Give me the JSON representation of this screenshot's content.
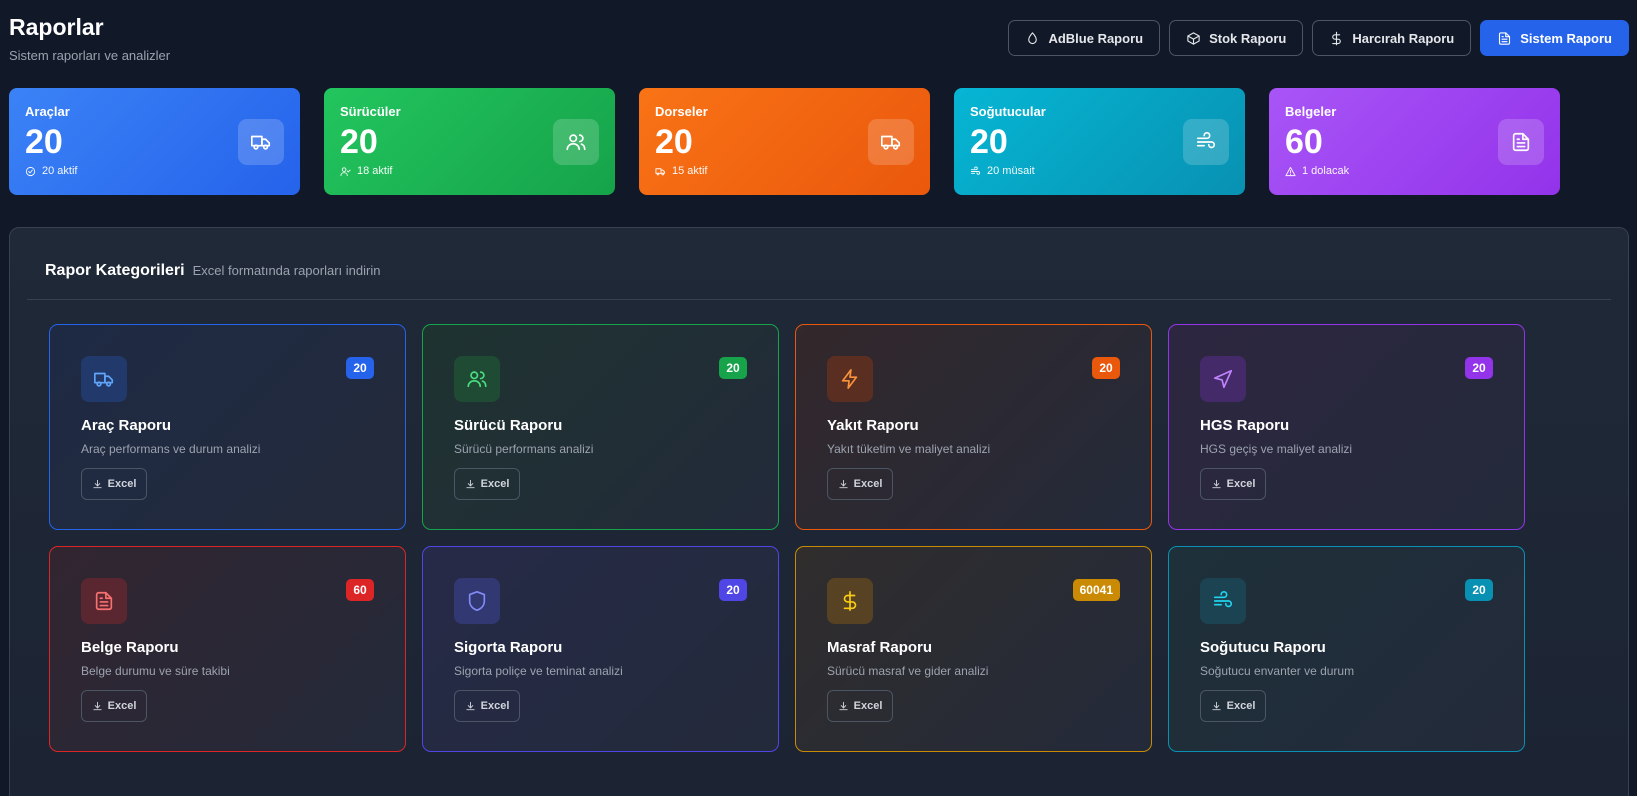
{
  "header": {
    "title": "Raporlar",
    "subtitle": "Sistem raporları ve analizler",
    "actions": [
      {
        "label": "AdBlue Raporu",
        "icon": "droplet-icon"
      },
      {
        "label": "Stok Raporu",
        "icon": "box-icon"
      },
      {
        "label": "Harcırah Raporu",
        "icon": "dollar-icon"
      },
      {
        "label": "Sistem Raporu",
        "icon": "file-text-icon",
        "primary": true
      }
    ]
  },
  "stats": [
    {
      "label": "Araçlar",
      "value": "20",
      "sub": "20 aktif",
      "icon": "truck-icon",
      "sub_icon": "check-circle-icon",
      "color_from": "#3b82f6",
      "color_to": "#2563eb"
    },
    {
      "label": "Sürücüler",
      "value": "20",
      "sub": "18 aktif",
      "icon": "users-icon",
      "sub_icon": "user-check-icon",
      "color_from": "#22c55e",
      "color_to": "#16a34a"
    },
    {
      "label": "Dorseler",
      "value": "20",
      "sub": "15 aktif",
      "icon": "truck-icon",
      "sub_icon": "truck-icon",
      "color_from": "#f97316",
      "color_to": "#ea580c"
    },
    {
      "label": "Soğutucular",
      "value": "20",
      "sub": "20 müsait",
      "icon": "wind-icon",
      "sub_icon": "wind-icon",
      "color_from": "#06b6d4",
      "color_to": "#0891b2"
    },
    {
      "label": "Belgeler",
      "value": "60",
      "sub": "1 dolacak",
      "icon": "file-text-icon",
      "sub_icon": "alert-triangle-icon",
      "color_from": "#a855f7",
      "color_to": "#9333ea"
    }
  ],
  "panel": {
    "title": "Rapor Kategorileri",
    "description": "Excel formatında raporları indirin"
  },
  "reports": [
    {
      "title": "Araç Raporu",
      "desc": "Araç performans ve durum analizi",
      "count": "20",
      "button": "Excel",
      "icon": "truck-icon",
      "accent": "#2563eb",
      "icon_color": "#60a5fa",
      "bg": "#1e2a44",
      "border": "#2563eb",
      "icon_bg": "#223a6b"
    },
    {
      "title": "Sürücü Raporu",
      "desc": "Sürücü performans analizi",
      "count": "20",
      "button": "Excel",
      "icon": "users-icon",
      "accent": "#16a34a",
      "icon_color": "#4ade80",
      "bg": "#1e3330",
      "border": "#16a34a",
      "icon_bg": "#1f4a33"
    },
    {
      "title": "Yakıt Raporu",
      "desc": "Yakıt tüketim ve maliyet analizi",
      "count": "20",
      "button": "Excel",
      "icon": "zap-icon",
      "accent": "#ea580c",
      "icon_color": "#fb923c",
      "bg": "#33282b",
      "border": "#ea580c",
      "icon_bg": "#5a2f22"
    },
    {
      "title": "HGS Raporu",
      "desc": "HGS geçiş ve maliyet analizi",
      "count": "20",
      "button": "Excel",
      "icon": "navigation-icon",
      "accent": "#9333ea",
      "icon_color": "#c084fc",
      "bg": "#2d2640",
      "border": "#9333ea",
      "icon_bg": "#452a6a"
    },
    {
      "title": "Belge Raporu",
      "desc": "Belge durumu ve süre takibi",
      "count": "60",
      "button": "Excel",
      "icon": "file-text-icon",
      "accent": "#dc2626",
      "icon_color": "#f87171",
      "bg": "#322530",
      "border": "#dc2626",
      "icon_bg": "#5a2630"
    },
    {
      "title": "Sigorta Raporu",
      "desc": "Sigorta poliçe ve teminat analizi",
      "count": "20",
      "button": "Excel",
      "icon": "shield-icon",
      "accent": "#4f46e5",
      "icon_color": "#818cf8",
      "bg": "#262a48",
      "border": "#4f46e5",
      "icon_bg": "#323872"
    },
    {
      "title": "Masraf Raporu",
      "desc": "Sürücü masraf ve gider analizi",
      "count": "60041",
      "button": "Excel",
      "icon": "dollar-icon",
      "accent": "#ca8a04",
      "icon_color": "#facc15",
      "bg": "#302d2c",
      "border": "#ca8a04",
      "icon_bg": "#574324"
    },
    {
      "title": "Soğutucu Raporu",
      "desc": "Soğutucu envanter ve durum",
      "count": "20",
      "button": "Excel",
      "icon": "wind-icon",
      "accent": "#0891b2",
      "icon_color": "#22d3ee",
      "bg": "#1e3039",
      "border": "#0891b2",
      "icon_bg": "#1c4352"
    }
  ]
}
